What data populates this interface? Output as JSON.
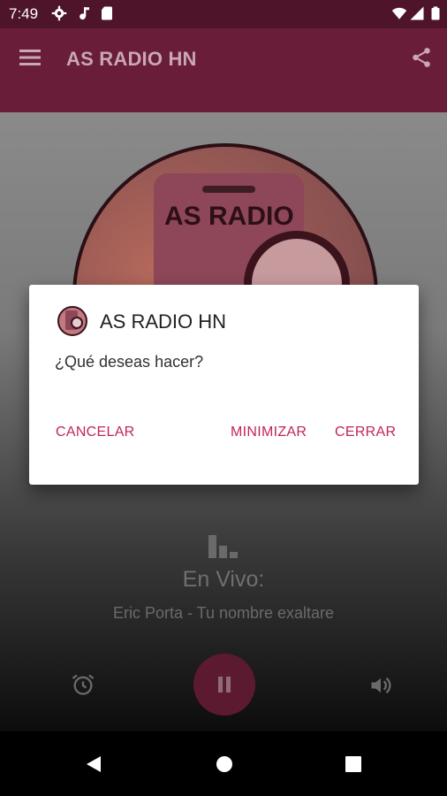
{
  "status_bar": {
    "time": "7:49"
  },
  "app_bar": {
    "title": "AS RADIO HN"
  },
  "logo": {
    "text": "AS RADIO"
  },
  "player": {
    "live_label": "En Vivo:",
    "now_playing": "Eric Porta - Tu nombre exaltare"
  },
  "dialog": {
    "title": "AS RADIO HN",
    "message": "¿Qué deseas hacer?",
    "cancel_label": "CANCELAR",
    "minimize_label": "MINIMIZAR",
    "close_label": "CERRAR"
  },
  "colors": {
    "accent": "#c0245c",
    "app_bar": "#6a1d39",
    "status_bar": "#4e1429"
  },
  "icons": [
    "gear-icon",
    "music-note-icon",
    "sd-card-icon",
    "wifi-icon",
    "signal-icon",
    "battery-icon",
    "menu-icon",
    "share-icon",
    "equalizer-icon",
    "alarm-icon",
    "pause-icon",
    "volume-icon",
    "back-icon",
    "home-icon",
    "recents-icon"
  ]
}
